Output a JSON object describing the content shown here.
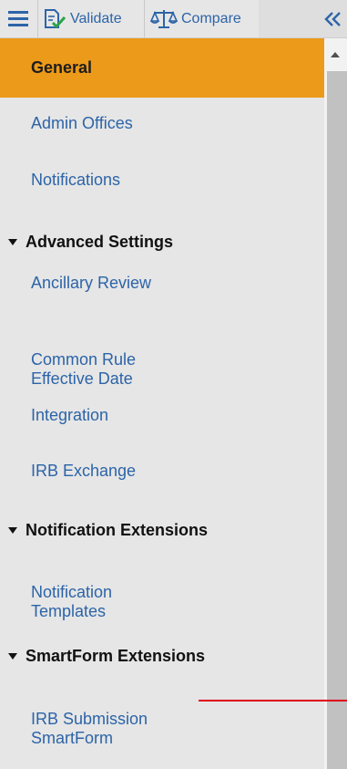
{
  "toolbar": {
    "validate_label": "Validate",
    "compare_label": "Compare",
    "collapse_icon": "double-chevron-left-icon",
    "accent_color": "#2c64a8"
  },
  "nav": {
    "items": [
      {
        "label": "General",
        "active": true
      },
      {
        "label": "Admin Offices"
      },
      {
        "label": "Notifications"
      }
    ],
    "sections": [
      {
        "title": "Advanced Settings",
        "items": [
          {
            "label": "Ancillary Review"
          },
          {
            "label": "Common Rule\nEffective Date"
          },
          {
            "label": "Integration"
          },
          {
            "label": "IRB Exchange"
          }
        ]
      },
      {
        "title": "Notification Extensions",
        "items": [
          {
            "label": "Notification\nTemplates"
          }
        ]
      },
      {
        "title": "SmartForm Extensions",
        "items": [
          {
            "label": "IRB Submission\nSmartForm"
          }
        ]
      }
    ],
    "active_color": "#ec9a1a"
  }
}
